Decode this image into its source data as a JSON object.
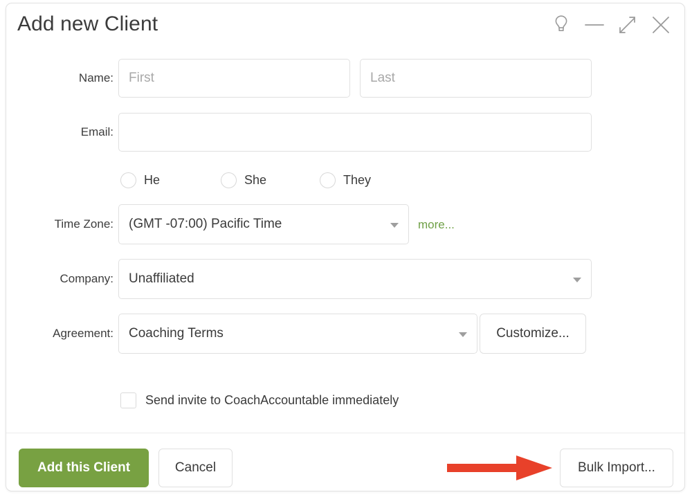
{
  "window": {
    "title": "Add new Client",
    "controls": [
      {
        "name": "lightbulb-icon",
        "label": "Tips"
      },
      {
        "name": "minimize-icon",
        "label": "Minimize"
      },
      {
        "name": "restore-icon",
        "label": "Restore down"
      },
      {
        "name": "close-icon",
        "label": "Close"
      }
    ]
  },
  "form": {
    "name": {
      "label": "Name:",
      "first": {
        "value": "",
        "placeholder": "First"
      },
      "last": {
        "value": "",
        "placeholder": "Last"
      }
    },
    "email": {
      "label": "Email:",
      "value": "",
      "placeholder": ""
    },
    "pronouns": {
      "selected": "",
      "options": [
        {
          "label": "He",
          "checked": false
        },
        {
          "label": "She",
          "checked": false
        },
        {
          "label": "They",
          "checked": false
        }
      ]
    },
    "time_zone": {
      "label": "Time Zone:",
      "value": "(GMT -07:00) Pacific Time",
      "more_link": "more..."
    },
    "company": {
      "label": "Company:",
      "value": "Unaffiliated"
    },
    "agreement": {
      "label": "Agreement:",
      "value": "Coaching Terms",
      "customize_label": "Customize..."
    },
    "send_invite": {
      "label": "Send invite to CoachAccountable immediately",
      "checked": false
    }
  },
  "footer": {
    "submit_label": "Add this Client",
    "cancel_label": "Cancel",
    "bulk_import_label": "Bulk Import..."
  },
  "annotation": {
    "type": "arrow",
    "points_to": "bulk-import-button",
    "color": "#e8412a"
  },
  "colors": {
    "primary_green": "#78a142",
    "link_green": "#6fa046",
    "annotation_red": "#e8412a",
    "text_dark": "#3a3a3a",
    "placeholder_gray": "#a8a8a8",
    "border_gray": "#e0e0e0"
  }
}
